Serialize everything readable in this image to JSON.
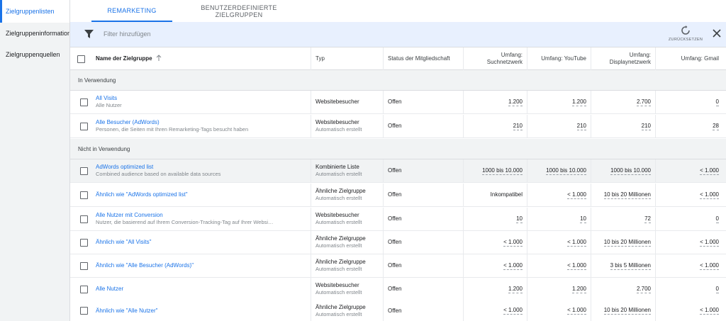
{
  "nav": [
    {
      "label": "Zielgruppenlisten",
      "active": true
    },
    {
      "label": "Zielgruppeninformationen",
      "active": false
    },
    {
      "label": "Zielgruppenquellen",
      "active": false
    }
  ],
  "tabs": [
    {
      "label": "Remarketing",
      "active": true
    },
    {
      "label": "Benutzerdefinierte Zielgruppen",
      "active": false
    }
  ],
  "filter": {
    "placeholder": "Filter hinzufügen",
    "reset_label": "ZURÜCKSETZEN"
  },
  "columns": {
    "name": "Name der Zielgruppe",
    "type": "Typ",
    "status": "Status der Mitgliedschaft",
    "search": "Umfang: Suchnetzwerk",
    "youtube": "Umfang: YouTube",
    "display": "Umfang: Displaynetzwerk",
    "gmail": "Umfang: Gmail"
  },
  "sections": [
    {
      "title": "In Verwendung",
      "rows": [
        {
          "name": "All Visits",
          "sub": "Alle Nutzer",
          "type": "Websitebesucher",
          "type_sub": "",
          "status": "Offen",
          "search": "1.200",
          "youtube": "1.200",
          "display": "2.700",
          "gmail": "0"
        },
        {
          "name": "Alle Besucher (AdWords)",
          "sub": "Personen, die Seiten mit Ihren Remarketing-Tags besucht haben",
          "type": "Websitebesucher",
          "type_sub": "Automatisch erstellt",
          "status": "Offen",
          "search": "210",
          "youtube": "210",
          "display": "210",
          "gmail": "28"
        }
      ]
    },
    {
      "title": "Nicht in Verwendung",
      "rows": [
        {
          "name": "AdWords optimized list",
          "sub": "Combined audience based on available data sources",
          "type": "Kombinierte Liste",
          "type_sub": "Automatisch erstellt",
          "status": "Offen",
          "search": "1000 bis 10.000",
          "youtube": "1000 bis 10.000",
          "display": "1000 bis 10.000",
          "gmail": "< 1.000"
        },
        {
          "name": "Ähnlich wie \"AdWords optimized list\"",
          "sub": "",
          "type": "Ähnliche Zielgruppe",
          "type_sub": "Automatisch erstellt",
          "status": "Offen",
          "search": "Inkompatibel",
          "youtube": "< 1.000",
          "display": "10 bis 20 Millionen",
          "gmail": "< 1.000"
        },
        {
          "name": "Alle Nutzer mit Conversion",
          "sub": "Nutzer, die basierend auf Ihrem Conversion-Tracking-Tag auf Ihrer Websi…",
          "type": "Websitebesucher",
          "type_sub": "Automatisch erstellt",
          "status": "Offen",
          "search": "10",
          "youtube": "10",
          "display": "72",
          "gmail": "0"
        },
        {
          "name": "Ähnlich wie \"All Visits\"",
          "sub": "",
          "type": "Ähnliche Zielgruppe",
          "type_sub": "Automatisch erstellt",
          "status": "Offen",
          "search": "< 1.000",
          "youtube": "< 1.000",
          "display": "10 bis 20 Millionen",
          "gmail": "< 1.000"
        },
        {
          "name": "Ähnlich wie \"Alle Besucher (AdWords)\"",
          "sub": "",
          "type": "Ähnliche Zielgruppe",
          "type_sub": "Automatisch erstellt",
          "status": "Offen",
          "search": "< 1.000",
          "youtube": "< 1.000",
          "display": "3 bis 5 Millionen",
          "gmail": "< 1.000"
        },
        {
          "name": "Alle Nutzer",
          "sub": "",
          "type": "Websitebesucher",
          "type_sub": "Automatisch erstellt",
          "status": "Offen",
          "search": "1.200",
          "youtube": "1.200",
          "display": "2.700",
          "gmail": "0"
        },
        {
          "name": "Ähnlich wie \"Alle Nutzer\"",
          "sub": "",
          "type": "Ähnliche Zielgruppe",
          "type_sub": "Automatisch erstellt",
          "status": "Offen",
          "search": "< 1.000",
          "youtube": "< 1.000",
          "display": "10 bis 20 Millionen",
          "gmail": "< 1.000"
        }
      ]
    }
  ],
  "colors": {
    "accent": "#1a73e8",
    "filter_bg": "#e8f0fe",
    "section_bg": "#f1f3f4"
  },
  "icons": {
    "filter": "filter-icon",
    "reset": "refresh-icon",
    "close": "close-icon",
    "sort": "arrow-up-icon"
  }
}
